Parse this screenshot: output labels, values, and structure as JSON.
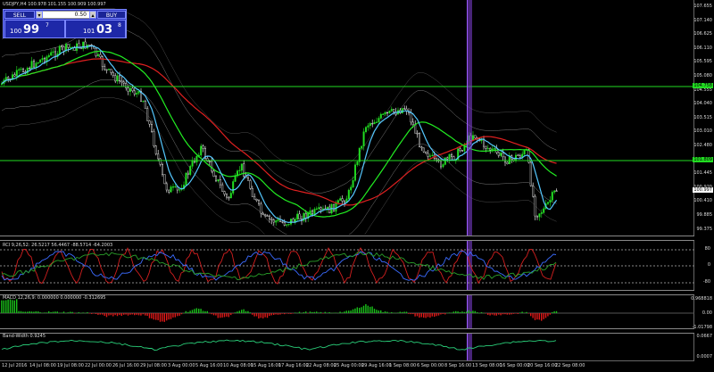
{
  "window_title": "USDJPY,H4  100.978 101.155 100.909 100.997",
  "trade_panel": {
    "sell_label": "SELL",
    "buy_label": "BUY",
    "lot_value": "0.50",
    "sell_prefix": "100",
    "sell_big": "99",
    "sell_sup": "7",
    "buy_prefix": "101",
    "buy_big": "03",
    "buy_sup": "8"
  },
  "price_axis": [
    "107.655",
    "107.140",
    "106.625",
    "106.110",
    "105.595",
    "105.080",
    "104.555",
    "104.040",
    "103.515",
    "103.010",
    "102.480",
    "101.965",
    "101.445",
    "100.920",
    "100.410",
    "99.885",
    "99.375"
  ],
  "hline_labels": {
    "upper": "104.758",
    "lower": "101.809",
    "bid": "100.997"
  },
  "rci": {
    "title": "RCI 9,26,52: 26.5217 56.4467 -88.5714 -64.2003",
    "levels": [
      "80",
      "0",
      "-80"
    ]
  },
  "macd": {
    "title": "MACD 12,26,9: 0.000000 0.000000 -0.312695",
    "levels": [
      "0.968818",
      "0.00",
      "-1.01798"
    ]
  },
  "bwidth": {
    "title": "Band-Width 0.9245",
    "levels": [
      "0.0667",
      "0.0007"
    ]
  },
  "time_axis": [
    "12 Jul 2016",
    "14 Jul 08:00",
    "19 Jul 08:00",
    "22 Jul 00:00",
    "26 Jul 16:00",
    "29 Jul 08:00",
    "3 Aug 00:00",
    "5 Aug 16:00",
    "10 Aug 08:00",
    "15 Aug 16:00",
    "17 Aug 16:00",
    "22 Aug 08:00",
    "25 Aug 00:00",
    "29 Aug 16:00",
    "1 Sep 08:00",
    "6 Sep 00:00",
    "8 Sep 16:00",
    "13 Sep 08:00",
    "16 Sep 00:00",
    "20 Sep 16:00",
    "22 Sep 08:00"
  ],
  "colors": {
    "background": "#000000",
    "bull": "#22dd22",
    "bear": "#ffffff",
    "ma_long": "#e02020",
    "ma_mid": "#22ee22",
    "ma_short": "#55c8ff",
    "band": "#9a9a9a",
    "hline": "#22dd22",
    "marker": "#8a4fe0"
  }
}
